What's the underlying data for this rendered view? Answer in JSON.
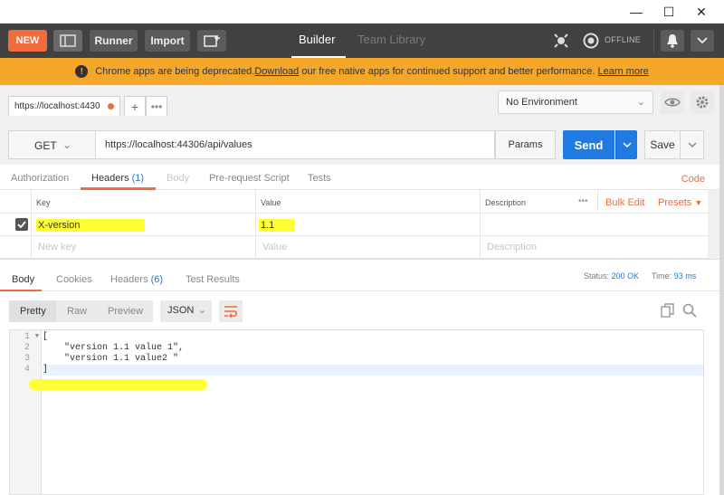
{
  "window": {
    "minimize": "—",
    "maximize": "☐",
    "close": "✕"
  },
  "header": {
    "new_label": "NEW",
    "runner_label": "Runner",
    "import_label": "Import",
    "tab_builder": "Builder",
    "tab_team_library": "Team Library",
    "offline_label": "OFFLINE"
  },
  "banner": {
    "text_before": "Chrome apps are being deprecated. ",
    "download_link": "Download",
    "text_middle": " our free native apps for continued support and better performance. ",
    "learn_more_link": "Learn more"
  },
  "tabs": {
    "request_tab_label": "https://localhost:4430",
    "plus": "+",
    "more": "•••"
  },
  "environment": {
    "selected": "No Environment"
  },
  "request": {
    "method": "GET",
    "url": "https://localhost:44306/api/values",
    "params_label": "Params",
    "send_label": "Send",
    "save_label": "Save"
  },
  "request_tabs": {
    "authorization": "Authorization",
    "headers": "Headers",
    "headers_count": "(1)",
    "body": "Body",
    "pre_request": "Pre-request Script",
    "tests": "Tests",
    "code": "Code"
  },
  "headers_table": {
    "col_key": "Key",
    "col_value": "Value",
    "col_description": "Description",
    "more": "•••",
    "bulk_edit": "Bulk Edit",
    "presets": "Presets",
    "rows": [
      {
        "key": "X-version",
        "value": "1.1",
        "description": ""
      }
    ],
    "placeholder_key": "New key",
    "placeholder_value": "Value",
    "placeholder_description": "Description"
  },
  "response_tabs": {
    "body": "Body",
    "cookies": "Cookies",
    "headers": "Headers",
    "headers_count": "(6)",
    "test_results": "Test Results",
    "status_label": "Status:",
    "status_value": "200 OK",
    "time_label": "Time:",
    "time_value": "93 ms"
  },
  "response_toolbar": {
    "pretty": "Pretty",
    "raw": "Raw",
    "preview": "Preview",
    "format": "JSON"
  },
  "editor": {
    "line_numbers": [
      "1",
      "2",
      "3",
      "4"
    ],
    "lines": [
      "[",
      "    \"version 1.1 value 1\",",
      "    \"version 1.1 value2 \"",
      "]"
    ]
  },
  "colors": {
    "accent_orange": "#f26b3a",
    "send_blue": "#1f7be2",
    "header_bg": "#414141",
    "banner_bg": "#f4a729",
    "highlight_yellow": "#ffff33"
  }
}
